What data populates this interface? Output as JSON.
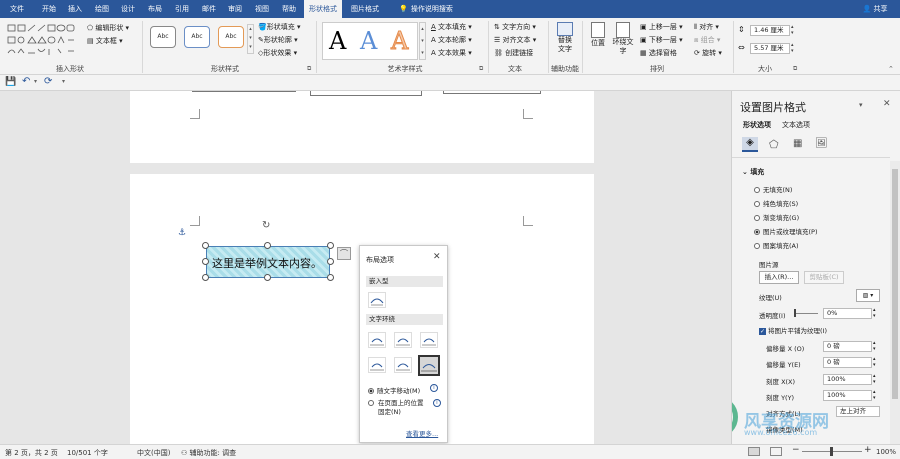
{
  "tabs": [
    "文件",
    "开始",
    "插入",
    "绘图",
    "设计",
    "布局",
    "引用",
    "邮件",
    "审阅",
    "视图",
    "帮助",
    "形状格式",
    "图片格式",
    "操作说明搜索"
  ],
  "active_tab": "形状格式",
  "share": "共享",
  "ribbon": {
    "insert_shapes": {
      "edit_shape": "编辑形状",
      "textbox": "文本框",
      "label": "插入形状"
    },
    "shape_styles": {
      "samples": [
        "Abc",
        "Abc",
        "Abc"
      ],
      "fill": "形状填充",
      "outline": "形状轮廓",
      "effects": "形状效果",
      "label": "形状样式"
    },
    "wordart": {
      "samples": [
        "A",
        "A",
        "A"
      ],
      "text_fill": "文本填充",
      "text_outline": "文本轮廓",
      "text_effects": "文本效果",
      "label": "艺术字样式"
    },
    "text": {
      "direction": "文字方向",
      "align": "对齐文本",
      "link": "创建链接",
      "label": "文本"
    },
    "accessibility": {
      "alt_text": "替换\n文字",
      "label": "辅助功能"
    },
    "arrange": {
      "position": "位置",
      "wrap": "环绕文\n字",
      "forward": "上移一层",
      "backward": "下移一层",
      "selection_pane": "选择窗格",
      "align": "对齐",
      "group": "组合",
      "rotate": "旋转",
      "label": "排列"
    },
    "size": {
      "height": "1.46 厘米",
      "width": "5.57 厘米",
      "label": "大小"
    }
  },
  "document": {
    "textbox_text": "这里是举例文本内容。"
  },
  "layout_popup": {
    "title": "布局选项",
    "inline_header": "嵌入型",
    "wrap_header": "文字环绕",
    "move_with_text": "随文字移动(M)",
    "fix_on_page": "在页面上的位置\n固定(N)",
    "see_more": "查看更多..."
  },
  "pane": {
    "title": "设置图片格式",
    "tabs": [
      "形状选项",
      "文本选项"
    ],
    "fill_section": "填充",
    "fill_options": [
      {
        "label": "无填充(N)",
        "checked": false
      },
      {
        "label": "纯色填充(S)",
        "checked": false
      },
      {
        "label": "渐变填充(G)",
        "checked": false
      },
      {
        "label": "图片或纹理填充(P)",
        "checked": true
      },
      {
        "label": "图案填充(A)",
        "checked": false
      }
    ],
    "picture_source": "图片源",
    "insert_btn": "插入(R)...",
    "clipboard_btn": "剪贴板(C)",
    "texture": "纹理(U)",
    "transparency": "透明度(I)",
    "transparency_value": "0%",
    "tile_checkbox": "将图片平铺为纹理(I)",
    "offset_x": "偏移量 X (O)",
    "offset_x_value": "0 磅",
    "offset_y": "偏移量 Y(E)",
    "offset_y_value": "0 磅",
    "scale_x": "刻度 X(X)",
    "scale_x_value": "100%",
    "scale_y": "刻度 Y(Y)",
    "scale_y_value": "100%",
    "align": "对齐方式(L)",
    "align_value": "左上对齐",
    "mirror": "镜像类型(M)"
  },
  "status": {
    "page": "第 2 页，共 2 页",
    "words": "10/501 个字",
    "lang": "中文(中国)",
    "accessibility": "辅助功能: 调查",
    "zoom": "100%"
  },
  "watermark": {
    "text": "风享资源网",
    "url": "www.office26.com"
  }
}
